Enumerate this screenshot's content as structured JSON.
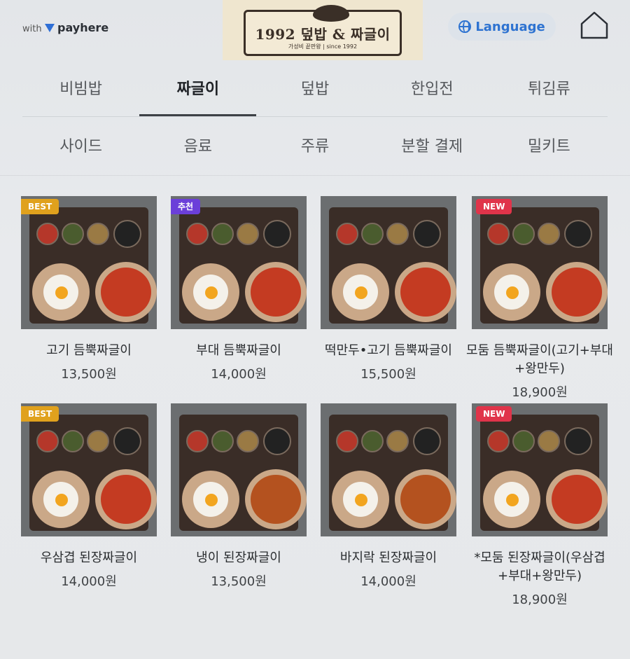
{
  "header": {
    "with_label": "with",
    "payhere_label": "payhere",
    "logo_title": "1992 덮밥 & 짜글이",
    "logo_sub": "가성비 끝판왕 | since 1992",
    "language_label": "Language",
    "accent": "#2e73d1"
  },
  "tabs_row1": [
    "비빔밥",
    "짜글이",
    "덮밥",
    "한입전",
    "튀김류"
  ],
  "tabs_row2": [
    "사이드",
    "음료",
    "주류",
    "분할 결제",
    "밀키트"
  ],
  "active_tab": "짜글이",
  "menu": [
    {
      "badge": "BEST",
      "name": "고기 듬뿍짜글이",
      "price": "13,500원"
    },
    {
      "badge": "추천",
      "name": "부대 듬뿍짜글이",
      "price": "14,000원"
    },
    {
      "badge": "",
      "name": "떡만두•고기 듬뿍짜글이",
      "price": "15,500원"
    },
    {
      "badge": "NEW",
      "name": "모둠 듬뿍짜글이(고기+부대+왕만두)",
      "price": "18,900원"
    },
    {
      "badge": "BEST",
      "name": "우삼겹 된장짜글이",
      "price": "14,000원"
    },
    {
      "badge": "",
      "name": "냉이 된장짜글이",
      "price": "13,500원"
    },
    {
      "badge": "",
      "name": "바지락 된장짜글이",
      "price": "14,000원"
    },
    {
      "badge": "NEW",
      "name": "*모둠 된장짜글이(우삼겹+부대+왕만두)",
      "price": "18,900원"
    }
  ]
}
